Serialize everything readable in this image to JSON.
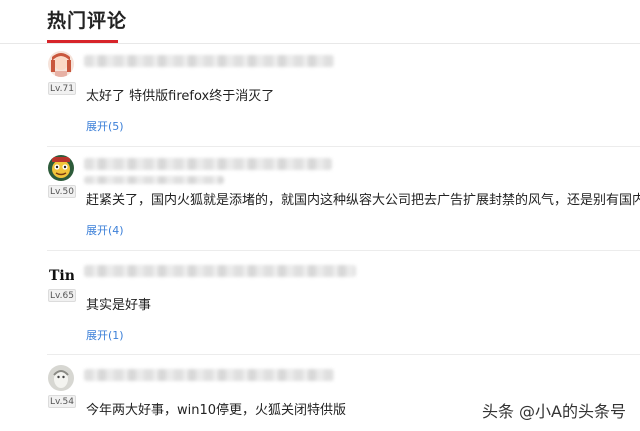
{
  "header": {
    "title": "热门评论"
  },
  "comments": [
    {
      "level": "Lv.71",
      "text": "太好了 特供版firefox终于消灭了",
      "expand": "展开(5)"
    },
    {
      "level": "Lv.50",
      "text": "赶紧关了，国内火狐就是添堵的，就国内这种纵容大公司把去广告扩展封禁的风气，还是别有国内版好",
      "expand": "展开(4)"
    },
    {
      "level": "Lv.65",
      "text": "其实是好事",
      "expand": "展开(1)"
    },
    {
      "level": "Lv.54",
      "text": "今年两大好事，win10停更，火狐关闭特供版"
    }
  ],
  "watermark": "头条 @小A的头条号",
  "colors": {
    "accent": "#d7242a",
    "link": "#3b7fd8"
  }
}
